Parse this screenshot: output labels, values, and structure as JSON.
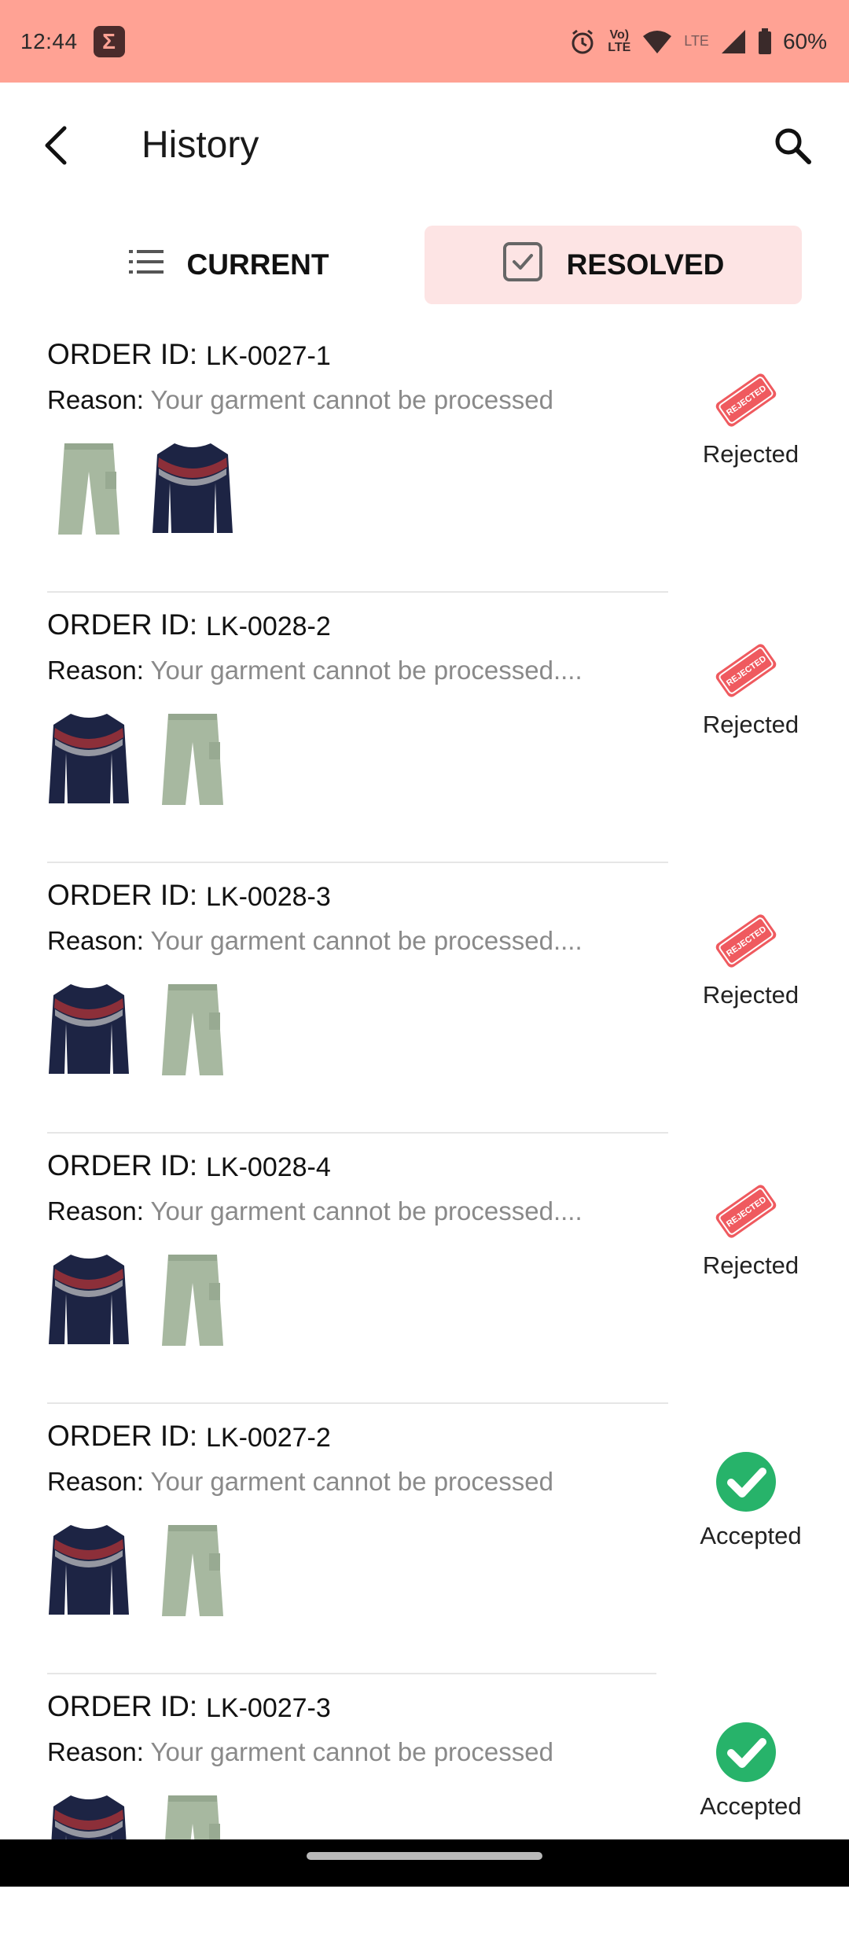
{
  "status_bar": {
    "time": "12:44",
    "app_icon": "sigma-icon",
    "network_small_1": "Vo)",
    "network_small_2": "LTE",
    "lte_label": "LTE",
    "battery_percent": "60%"
  },
  "app_bar": {
    "title": "History",
    "back_icon": "back-arrow-icon",
    "search_icon": "search-icon"
  },
  "tabs": [
    {
      "label": "CURRENT",
      "icon": "list-icon",
      "selected": false
    },
    {
      "label": "RESOLVED",
      "icon": "checkbox-icon",
      "selected": true
    }
  ],
  "orders_common": {
    "order_id_label": "ORDER ID:",
    "reason_label": "Reason:"
  },
  "orders": [
    {
      "id": "LK-0027-1",
      "reason": "Your garment cannot be processed",
      "status": "Rejected",
      "thumbs": [
        "pants",
        "sweater"
      ]
    },
    {
      "id": "LK-0028-2",
      "reason": "Your garment cannot be processed....",
      "status": "Rejected",
      "thumbs": [
        "sweater",
        "pants"
      ]
    },
    {
      "id": "LK-0028-3",
      "reason": "Your garment cannot be processed....",
      "status": "Rejected",
      "thumbs": [
        "sweater",
        "pants"
      ]
    },
    {
      "id": "LK-0028-4",
      "reason": "Your garment cannot be processed....",
      "status": "Rejected",
      "thumbs": [
        "sweater",
        "pants"
      ]
    },
    {
      "id": "LK-0027-2",
      "reason": "Your garment cannot be processed",
      "status": "Accepted",
      "thumbs": [
        "sweater",
        "pants"
      ]
    },
    {
      "id": "LK-0027-3",
      "reason": "Your garment cannot be processed",
      "status": "Accepted",
      "thumbs": [
        "sweater",
        "pants"
      ]
    }
  ],
  "stamp_text": "REJECTED",
  "colors": {
    "status_bar_bg": "#FFA294",
    "selected_tab_bg": "#FDE4E4",
    "rejected_stamp": "#EF5A5F",
    "accepted_green": "#27B36A",
    "reason_gray": "#8a8a8a"
  }
}
